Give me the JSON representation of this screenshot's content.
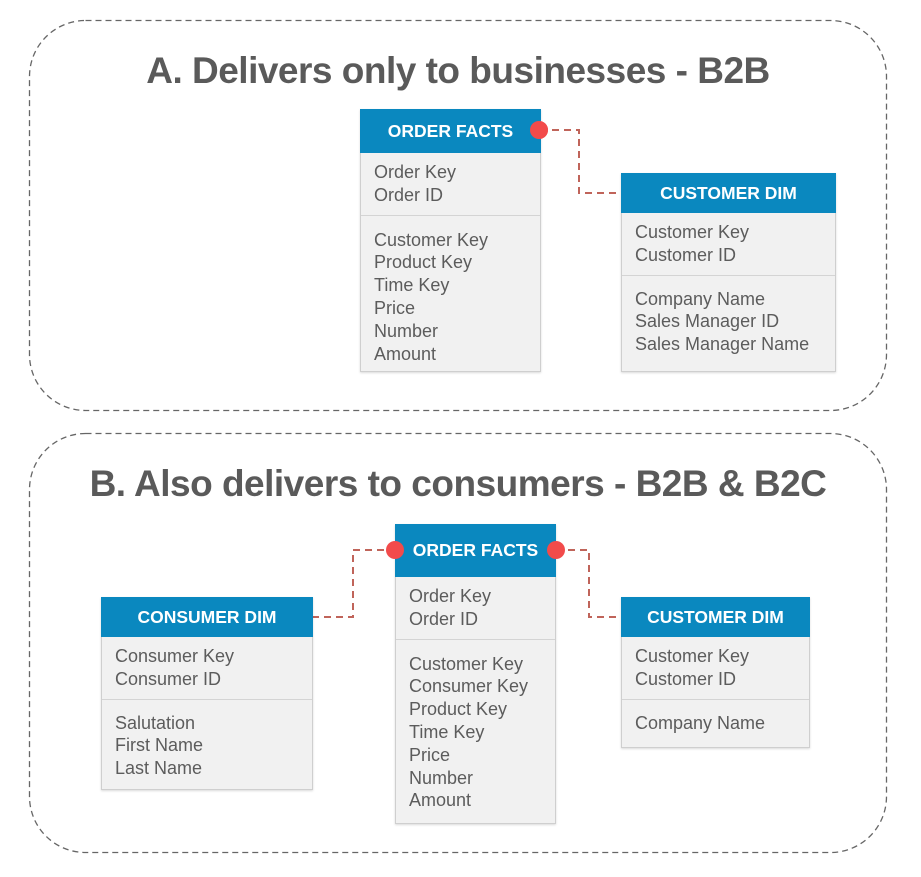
{
  "colors": {
    "header_bg": "#0a88bf",
    "header_text": "#ffffff",
    "body_bg": "#f1f1f1",
    "field_text": "#5c5c5c",
    "title_text": "#5a5a5a",
    "panel_border": "#666666",
    "connector_line": "#c0645a",
    "connector_dot": "#f24b4b"
  },
  "panels": [
    {
      "title": "A. Delivers only to businesses - B2B",
      "entities": {
        "order_facts": {
          "title": "ORDER FACTS",
          "key_fields": [
            "Order Key",
            "Order ID"
          ],
          "other_fields": [
            "Customer Key",
            "Product Key",
            "Time Key",
            "Price",
            "Number",
            "Amount"
          ]
        },
        "customer_dim": {
          "title": "CUSTOMER DIM",
          "key_fields": [
            "Customer Key",
            "Customer ID"
          ],
          "other_fields": [
            "Company Name",
            "Sales Manager ID",
            "Sales Manager Name"
          ]
        }
      },
      "relationships": [
        {
          "from": "ORDER FACTS",
          "to": "CUSTOMER DIM",
          "style": "dashed"
        }
      ]
    },
    {
      "title": "B. Also delivers to consumers - B2B & B2C",
      "entities": {
        "consumer_dim": {
          "title": "CONSUMER DIM",
          "key_fields": [
            "Consumer Key",
            "Consumer ID"
          ],
          "other_fields": [
            "Salutation",
            "First Name",
            "Last Name"
          ]
        },
        "order_facts": {
          "title": "ORDER FACTS",
          "key_fields": [
            "Order Key",
            "Order ID"
          ],
          "other_fields": [
            "Customer Key",
            "Consumer Key",
            "Product Key",
            "Time Key",
            "Price",
            "Number",
            "Amount"
          ]
        },
        "customer_dim": {
          "title": "CUSTOMER DIM",
          "key_fields": [
            "Customer Key",
            "Customer ID"
          ],
          "other_fields": [
            "Company Name"
          ]
        }
      },
      "relationships": [
        {
          "from": "ORDER FACTS",
          "to": "CONSUMER DIM",
          "style": "dashed"
        },
        {
          "from": "ORDER FACTS",
          "to": "CUSTOMER DIM",
          "style": "dashed"
        }
      ]
    }
  ]
}
